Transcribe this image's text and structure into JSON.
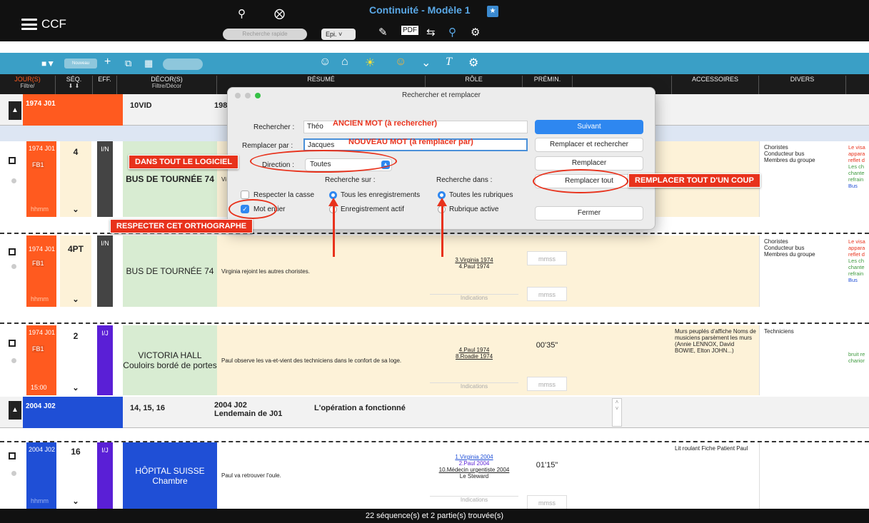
{
  "app": {
    "name": "CCF",
    "document_title": "Continuité - Modèle 1"
  },
  "topbar": {
    "search_placeholder": "Recherche rapide",
    "episode_select": "Epi.",
    "icons": [
      "search-icon",
      "clear-icon",
      "edit-icon",
      "pdf-icon",
      "swap-icon",
      "filter-icon",
      "user-settings-icon"
    ]
  },
  "toolbar": {
    "mini_select": "Nouveau",
    "icons": [
      "checkbox-dropdown-icon",
      "add-icon",
      "duplicate-icon",
      "grid-icon",
      "pill-toggle",
      "face-icon",
      "home-icon",
      "sun-icon",
      "smiley-icon",
      "chevron-down-icon",
      "clear-format-icon",
      "gear-icon"
    ]
  },
  "columns": {
    "jour": "JOUR(S)",
    "jour_sub": "Filtre/",
    "seq": "SÉQ.",
    "eff": "EFF.",
    "decor": "DÉCOR(S)",
    "decor_sub": "Filtre/Décor",
    "resume": "RÉSUMÉ",
    "role": "RÔLE",
    "premin": "PRÉMIN.",
    "accessoires": "ACCESSOIRES",
    "divers": "DIVERS"
  },
  "group1": {
    "day": "1974 J01",
    "decor": "10VID",
    "extra": "198"
  },
  "group2": {
    "day": "2004 J02",
    "seqs": "14, 15, 16",
    "title1": "2004 J02",
    "title2": "Lendemain de J01",
    "summary": "L'opération a fonctionné"
  },
  "scenes": [
    {
      "day": "1974 J01",
      "code": "FB1",
      "time": "hhmm",
      "seq": "4",
      "eff": "I/N",
      "decor": "BUS DE TOURNÉE 74",
      "resume": "Vi",
      "divers": [
        "Choristes",
        "Conducteur bus",
        "Membres du groupe"
      ],
      "extra": [
        "Le visa",
        "appara",
        "reflet d",
        "Les ch",
        "chante",
        "refrain",
        "Bus"
      ]
    },
    {
      "day": "1974 J01",
      "code": "FB1",
      "time": "hhmm",
      "seq": "4PT",
      "eff": "I/N",
      "decor": "BUS DE TOURNÉE 74",
      "resume": "Virginia rejoint les autres choristes.",
      "roles": [
        "3.Virginia 1974",
        "4.Paul 1974"
      ],
      "indications": "Indications",
      "mmss1": "mmss",
      "mmss2": "mmss",
      "divers": [
        "Choristes",
        "Conducteur bus",
        "Membres du groupe"
      ],
      "extra": [
        "Le visa",
        "appara",
        "reflet d",
        "Les ch",
        "chante",
        "refrain",
        "Bus"
      ]
    },
    {
      "day": "1974 J01",
      "code": "FB1",
      "time": "15:00",
      "seq": "2",
      "eff": "I/J",
      "decor": "VICTORIA HALL Couloirs bordé de portes",
      "resume": "Paul observe les va-et-vient des techniciens dans le confort de sa loge.",
      "roles": [
        "4.Paul 1974",
        "8.Roadie 1974"
      ],
      "indications": "Indications",
      "duration": "00'35\"",
      "mmss": "mmss",
      "accessoires": "Murs peuplés d'affiche Noms de musiciens parsèment les murs (Annie LENNOX, David BOWIE, Elton JOHN...)",
      "divers": [
        "Techniciens"
      ],
      "extra": [
        "bruit re",
        "charior"
      ]
    },
    {
      "day": "2004 J02",
      "time": "hhmm",
      "seq": "16",
      "eff": "I/J",
      "decor": "HÔPITAL SUISSE Chambre",
      "resume": "Paul va retrouver l'oule.",
      "roles": [
        "1.Virginia 2004",
        "2.Paul 2004",
        "10.Médecin urgentiste 2004",
        "Le Steward"
      ],
      "indications": "Indications",
      "duration": "01'15\"",
      "mmss": "mmss",
      "accessoires": "Lit roulant Fiche Patient Paul"
    }
  ],
  "dialog": {
    "title": "Rechercher et remplacer",
    "search_label": "Rechercher :",
    "search_value": "Théo",
    "replace_label": "Remplacer par :",
    "replace_value": "Jacques",
    "direction_label": "Direction :",
    "direction_value": "Toutes",
    "search_on_label": "Recherche sur :",
    "search_in_label": "Recherche dans :",
    "respect_case": "Respecter la casse",
    "whole_word": "Mot entier",
    "all_records": "Tous les enregistrements",
    "active_record": "Enregistrement actif",
    "all_fields": "Toutes les rubriques",
    "active_field": "Rubrique active",
    "btn_next": "Suivant",
    "btn_replace_search": "Remplacer et rechercher",
    "btn_replace": "Remplacer",
    "btn_replace_all": "Remplacer tout",
    "btn_close": "Fermer"
  },
  "annotations": {
    "old_word": "ANCIEN MOT (à rechercher)",
    "new_word": "NOUVEAU MOT (à remplacer par)",
    "whole_software": "DANS TOUT LE LOGICIEL",
    "replace_all": "REMPLACER TOUT D'UN COUP",
    "respect_spelling": "RESPECTER CET ORTHOGRAPHE"
  },
  "status": {
    "text": "22 séquence(s) et 2 partie(s) trouvée(s)"
  },
  "colors": {
    "orange": "#ff5a1f",
    "blue": "#1f4fd6",
    "purple": "#5a1fd6",
    "accent": "#3a9fc6",
    "red_annotation": "#e8321c"
  }
}
